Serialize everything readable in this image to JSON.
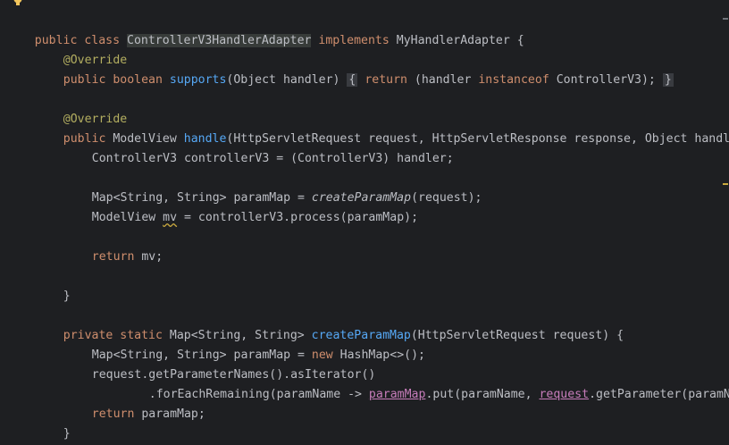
{
  "editor": {
    "lines": [
      {
        "id": "l1",
        "tokens": [
          "public",
          " ",
          "class",
          " ",
          "ControllerV3HandlerAdapter",
          " ",
          "implements",
          " ",
          "MyHandlerAdapter",
          " {"
        ]
      },
      {
        "id": "l2",
        "tokens": [
          "@Override"
        ]
      },
      {
        "id": "l3",
        "tokens": [
          "public",
          " ",
          "boolean",
          " ",
          "supports",
          "(Object handler) ",
          "{",
          " ",
          "return",
          " (handler ",
          "instanceof",
          " ControllerV3);",
          " ",
          "}"
        ]
      },
      {
        "id": "l5",
        "tokens": [
          "@Override"
        ]
      },
      {
        "id": "l6",
        "tokens": [
          "public",
          " ModelView ",
          "handle",
          "(HttpServletRequest request, HttpServletResponse response, Object handler) {"
        ]
      },
      {
        "id": "l7",
        "tokens": [
          "ControllerV3 controllerV3 = (ControllerV3) handler;"
        ]
      },
      {
        "id": "l9",
        "tokens": [
          "Map<String, String> paramMap = ",
          "createParamMap",
          "(request);"
        ]
      },
      {
        "id": "l10",
        "tokens": [
          "ModelView ",
          "mv",
          " = controllerV3.process(paramMap);"
        ]
      },
      {
        "id": "l12",
        "tokens": [
          "return",
          " mv;"
        ]
      },
      {
        "id": "l14",
        "tokens": [
          "}"
        ]
      },
      {
        "id": "l16",
        "tokens": [
          "private",
          " ",
          "static",
          " Map<String, String> ",
          "createParamMap",
          "(HttpServletRequest request) {"
        ]
      },
      {
        "id": "l17",
        "tokens": [
          "Map<String, String> paramMap = ",
          "new",
          " HashMap<>();"
        ]
      },
      {
        "id": "l18",
        "tokens": [
          "request.getParameterNames().asIterator()"
        ]
      },
      {
        "id": "l19",
        "tokens": [
          ".forEachRemaining(paramName -> ",
          "paramMap",
          ".put(paramName, ",
          "request",
          ".getParameter(paramName)));"
        ]
      },
      {
        "id": "l20",
        "tokens": [
          "return",
          " paramMap;"
        ]
      },
      {
        "id": "l21",
        "tokens": [
          "}"
        ]
      },
      {
        "id": "l22",
        "tokens": [
          "}"
        ]
      }
    ]
  },
  "colors": {
    "background": "#1e1f22",
    "keyword": "#cf8e6d",
    "annotation": "#b3ae60",
    "method": "#56a8f5",
    "text": "#bcbec4",
    "captured_var": "#c77dbb"
  },
  "icons": {
    "intention": "lightbulb-icon"
  }
}
